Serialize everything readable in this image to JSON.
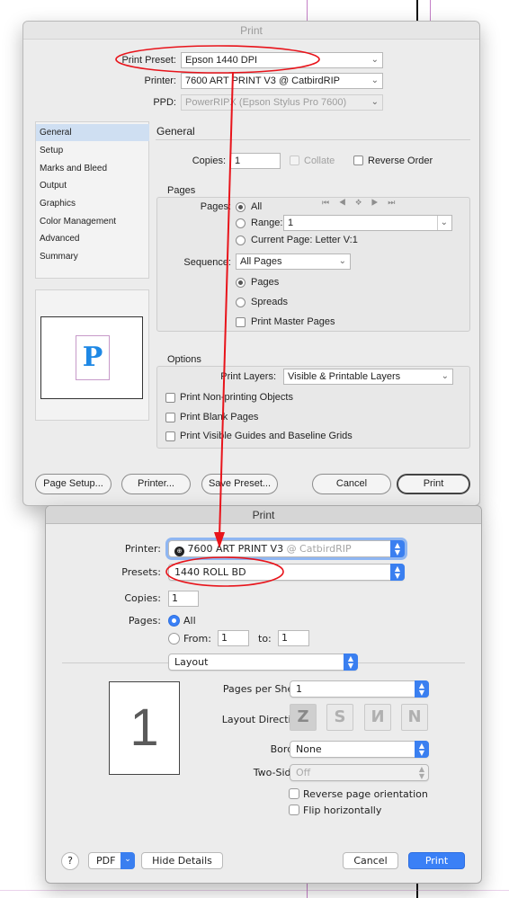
{
  "indesign": {
    "title": "Print",
    "print_preset_label": "Print Preset:",
    "print_preset_value": "Epson 1440 DPI",
    "printer_label": "Printer:",
    "printer_value": "7600 ART PRINT V3 @ CatbirdRIP",
    "ppd_label": "PPD:",
    "ppd_value": "PowerRIPX (Epson Stylus Pro 7600)",
    "sidebar": [
      {
        "label": "General"
      },
      {
        "label": "Setup"
      },
      {
        "label": "Marks and Bleed"
      },
      {
        "label": "Output"
      },
      {
        "label": "Graphics"
      },
      {
        "label": "Color Management"
      },
      {
        "label": "Advanced"
      },
      {
        "label": "Summary"
      }
    ],
    "preview_letter": "P",
    "section_heading": "General",
    "copies_label": "Copies:",
    "copies_value": "1",
    "collate_label": "Collate",
    "reverse_order_label": "Reverse Order",
    "pages_group": {
      "title": "Pages",
      "pages_label": "Pages:",
      "all_label": "All",
      "range_label": "Range:",
      "range_value": "1",
      "current_page_label": "Current Page: Letter V:1",
      "sequence_label": "Sequence:",
      "sequence_value": "All Pages",
      "pages_radio_label": "Pages",
      "spreads_label": "Spreads",
      "print_master_pages_label": "Print Master Pages"
    },
    "options_group": {
      "title": "Options",
      "print_layers_label": "Print Layers:",
      "print_layers_value": "Visible & Printable Layers",
      "non_printing_label": "Print Non-printing Objects",
      "blank_pages_label": "Print Blank Pages",
      "guides_label": "Print Visible Guides and Baseline Grids"
    },
    "buttons": {
      "page_setup": "Page Setup...",
      "printer": "Printer...",
      "save_preset": "Save Preset...",
      "cancel": "Cancel",
      "print": "Print"
    }
  },
  "macos": {
    "title": "Print",
    "printer_label": "Printer:",
    "printer_name": "7600 ART PRINT V3",
    "printer_suffix": "@ CatbirdRIP",
    "presets_label": "Presets:",
    "presets_value": "1440 ROLL BD",
    "copies_label": "Copies:",
    "copies_value": "1",
    "pages_label": "Pages:",
    "all_label": "All",
    "from_label": "From:",
    "from_value": "1",
    "to_label": "to:",
    "to_value": "1",
    "section_value": "Layout",
    "preview_number": "1",
    "pages_per_sheet_label": "Pages per Sheet:",
    "pages_per_sheet_value": "1",
    "layout_direction_label": "Layout Direction:",
    "border_label": "Border:",
    "border_value": "None",
    "two_sided_label": "Two-Sided:",
    "two_sided_value": "Off",
    "reverse_orientation_label": "Reverse page orientation",
    "flip_horizontally_label": "Flip horizontally",
    "help_label": "?",
    "pdf_label": "PDF",
    "hide_details_label": "Hide Details",
    "cancel_label": "Cancel",
    "print_label": "Print"
  },
  "annotation_color": "#e8141b"
}
